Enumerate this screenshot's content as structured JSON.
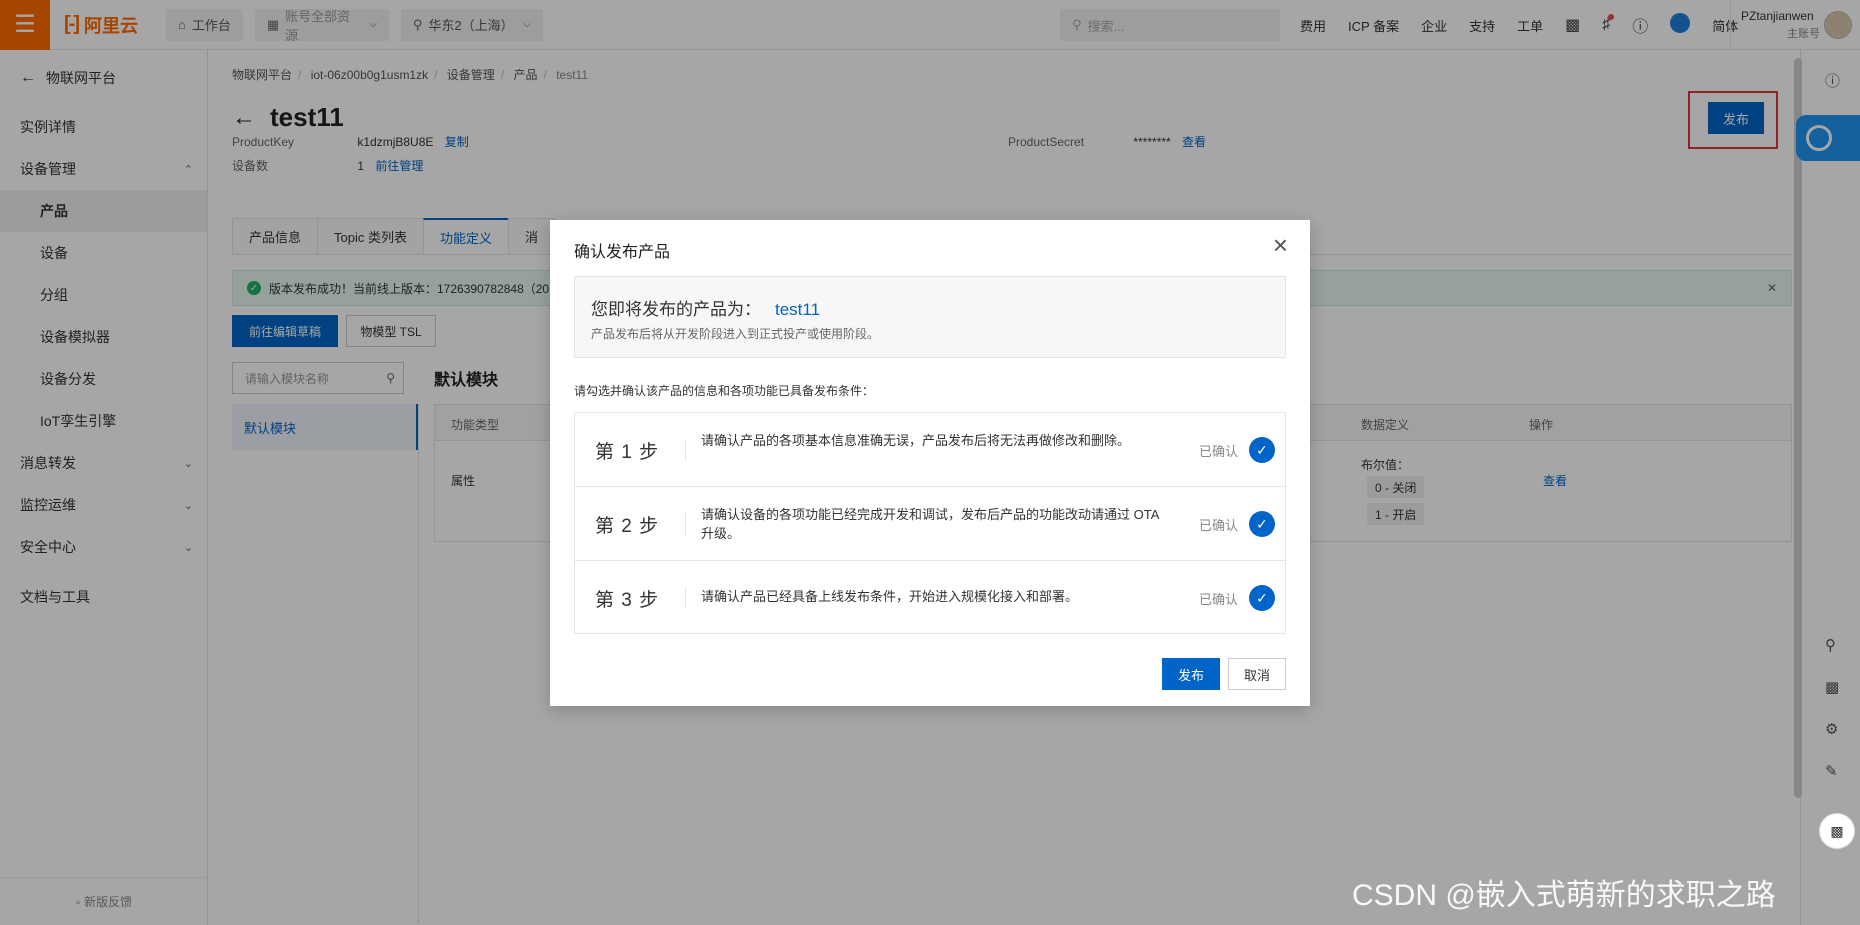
{
  "topbar": {
    "logo": "阿里云",
    "workbench": "工作台",
    "resources": "账号全部资源",
    "region": "华东2（上海）",
    "search_placeholder": "搜索...",
    "links": [
      "费用",
      "ICP 备案",
      "企业",
      "支持",
      "工单"
    ],
    "lang": "简体",
    "user_name": "PZtanjianwen",
    "user_role": "主账号"
  },
  "sidebar": {
    "back_label": "物联网平台",
    "items": [
      {
        "label": "实例详情",
        "level": 1
      },
      {
        "label": "设备管理",
        "level": 1,
        "expanded": true
      },
      {
        "label": "产品",
        "level": 2,
        "active": true
      },
      {
        "label": "设备",
        "level": 2
      },
      {
        "label": "分组",
        "level": 2
      },
      {
        "label": "设备模拟器",
        "level": 2
      },
      {
        "label": "设备分发",
        "level": 2
      },
      {
        "label": "IoT孪生引擎",
        "level": 2
      },
      {
        "label": "消息转发",
        "level": 1
      },
      {
        "label": "监控运维",
        "level": 1
      },
      {
        "label": "安全中心",
        "level": 1
      },
      {
        "label": "文档与工具",
        "level": 1
      }
    ],
    "feedback": "新版反馈"
  },
  "main": {
    "breadcrumb": [
      "物联网平台",
      "iot-06z00b0g1usm1zk",
      "设备管理",
      "产品",
      "test11"
    ],
    "title": "test11",
    "publish_label": "发布",
    "product_key_label": "ProductKey",
    "product_key": "k1dzmjB8U8E",
    "copy_label": "复制",
    "device_count_label": "设备数",
    "device_count": "1",
    "manage_label": "前往管理",
    "product_secret_label": "ProductSecret",
    "product_secret": "********",
    "view_label": "查看",
    "tabs": [
      "产品信息",
      "Topic 类列表",
      "功能定义",
      "消"
    ],
    "success_msg": "版本发布成功！当前线上版本：1726390782848（20",
    "edit_draft_label": "前往编辑草稿",
    "tsl_label": "物模型 TSL",
    "module_search_placeholder": "请输入模块名称",
    "default_module": "默认模块",
    "module_title": "默认模块",
    "table": {
      "col_type": "功能类型",
      "col_datadef": "数据定义",
      "col_action": "操作",
      "row_type": "属性",
      "bool_label": "布尔值：",
      "bool_false": "0 - 关闭",
      "bool_true": "1 - 开启",
      "row_action": "查看"
    }
  },
  "modal": {
    "title": "确认发布产品",
    "product_prefix": "您即将发布的产品为：",
    "product_name": "test11",
    "product_note": "产品发布后将从开发阶段进入到正式投产或使用阶段。",
    "check_hint": "请勾选并确认该产品的信息和各项功能已具备发布条件：",
    "steps": [
      {
        "label": "第 1 步",
        "text": "请确认产品的各项基本信息准确无误，产品发布后将无法再做修改和删除。",
        "status": "已确认"
      },
      {
        "label": "第 2 步",
        "text": "请确认设备的各项功能已经完成开发和调试，发布后产品的功能改动请通过 OTA 升级。",
        "status": "已确认"
      },
      {
        "label": "第 3 步",
        "text": "请确认产品已经具备上线发布条件，开始进入规模化接入和部署。",
        "status": "已确认"
      }
    ],
    "publish_label": "发布",
    "cancel_label": "取消"
  },
  "watermark": "CSDN @嵌入式萌新的求职之路",
  "colors": {
    "brand": "#ff6a00",
    "primary": "#0064c8",
    "success": "#23b066",
    "highlight_border": "#e5333a"
  }
}
